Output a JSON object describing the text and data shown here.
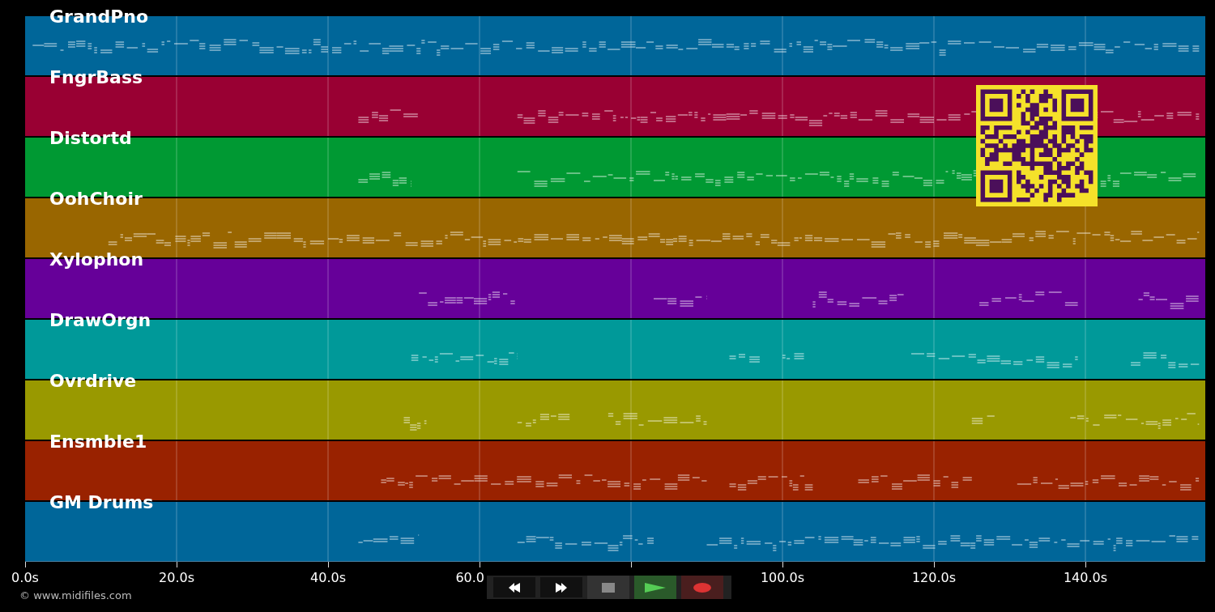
{
  "tracks": [
    {
      "name": "GrandPno",
      "color": "#006699"
    },
    {
      "name": "FngrBass",
      "color": "#990033"
    },
    {
      "name": "Distortd",
      "color": "#009933"
    },
    {
      "name": "OohChoir",
      "color": "#996600"
    },
    {
      "name": "Xylophon",
      "color": "#660099"
    },
    {
      "name": "DrawOrgn",
      "color": "#009999"
    },
    {
      "name": "Ovrdrive",
      "color": "#999900"
    },
    {
      "name": "Ensmble1",
      "color": "#992200"
    },
    {
      "name": "GM Drums",
      "color": "#006699"
    }
  ],
  "time_axis": {
    "ticks": [
      {
        "kind": "labeled",
        "label": "0.0s"
      },
      {
        "kind": "labeled",
        "label": "20.0s"
      },
      {
        "kind": "labeled",
        "label": "40.0s"
      },
      {
        "kind": "cut",
        "label": "60.0"
      },
      {
        "kind": "bare"
      },
      {
        "kind": "labeled",
        "label": "100.0s"
      },
      {
        "kind": "labeled",
        "label": "120.0s"
      },
      {
        "kind": "labeled",
        "label": "140.0s"
      }
    ]
  },
  "copyright": "© www.midifiles.com",
  "transport": {
    "buttons": [
      {
        "kind": "rewind"
      },
      {
        "kind": "forward"
      },
      {
        "kind": "stop"
      },
      {
        "kind": "play"
      },
      {
        "kind": "record"
      }
    ]
  }
}
